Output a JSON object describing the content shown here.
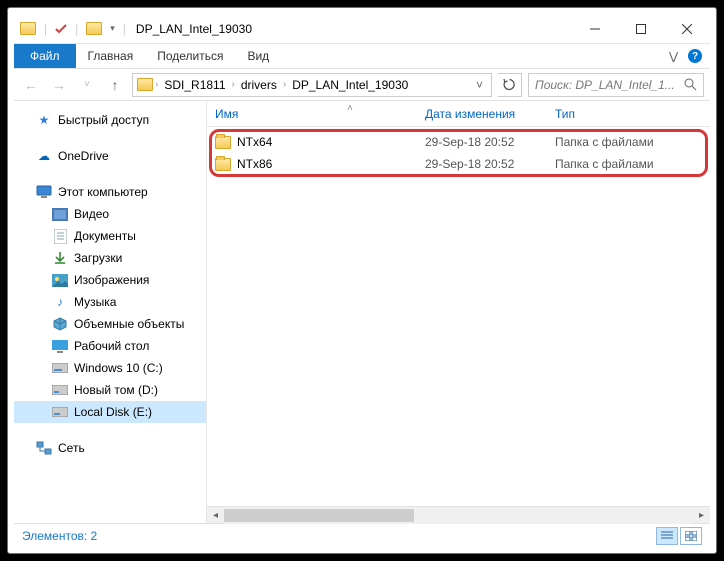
{
  "window": {
    "title": "DP_LAN_Intel_19030"
  },
  "ribbon": {
    "file": "Файл",
    "tabs": [
      "Главная",
      "Поделиться",
      "Вид"
    ]
  },
  "breadcrumb": {
    "items": [
      "SDI_R1811",
      "drivers",
      "DP_LAN_Intel_19030"
    ]
  },
  "search": {
    "placeholder": "Поиск: DP_LAN_Intel_1..."
  },
  "nav": {
    "quick_access": "Быстрый доступ",
    "onedrive": "OneDrive",
    "this_pc": "Этот компьютер",
    "children": [
      {
        "label": "Видео"
      },
      {
        "label": "Документы"
      },
      {
        "label": "Загрузки"
      },
      {
        "label": "Изображения"
      },
      {
        "label": "Музыка"
      },
      {
        "label": "Объемные объекты"
      },
      {
        "label": "Рабочий стол"
      },
      {
        "label": "Windows 10 (C:)"
      },
      {
        "label": "Новый том (D:)"
      },
      {
        "label": "Local Disk (E:)"
      }
    ],
    "network": "Сеть"
  },
  "columns": {
    "name": "Имя",
    "date": "Дата изменения",
    "type": "Тип"
  },
  "files": [
    {
      "name": "NTx64",
      "date": "29-Sep-18 20:52",
      "type": "Папка с файлами"
    },
    {
      "name": "NTx86",
      "date": "29-Sep-18 20:52",
      "type": "Папка с файлами"
    }
  ],
  "status": {
    "text": "Элементов: 2"
  }
}
